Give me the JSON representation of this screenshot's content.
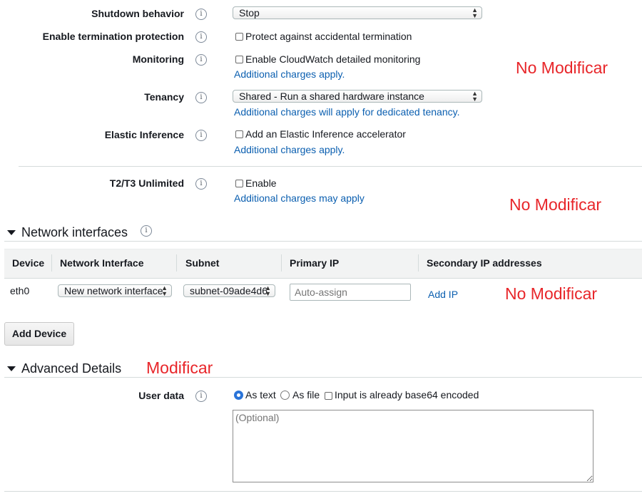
{
  "rows": {
    "shutdown": {
      "label": "Shutdown behavior",
      "value": "Stop"
    },
    "termination": {
      "label": "Enable termination protection",
      "checkbox": "Protect against accidental termination"
    },
    "monitoring": {
      "label": "Monitoring",
      "checkbox": "Enable CloudWatch detailed monitoring",
      "link": "Additional charges apply."
    },
    "tenancy": {
      "label": "Tenancy",
      "value": "Shared - Run a shared hardware instance",
      "link": "Additional charges will apply for dedicated tenancy."
    },
    "elastic": {
      "label": "Elastic Inference",
      "checkbox": "Add an Elastic Inference accelerator",
      "link": "Additional charges apply."
    },
    "t2t3": {
      "label": "T2/T3 Unlimited",
      "checkbox": "Enable",
      "link": "Additional charges may apply"
    }
  },
  "annotations": {
    "no_mod_1": "No Modificar",
    "no_mod_2": "No Modificar",
    "no_mod_3": "No Modificar",
    "mod": "Modificar"
  },
  "network": {
    "title": "Network interfaces",
    "headers": [
      "Device",
      "Network Interface",
      "Subnet",
      "Primary IP",
      "Secondary IP addresses"
    ],
    "row": {
      "device": "eth0",
      "interface": "New network interface",
      "subnet": "subnet-09ade4d6",
      "primary_ip_placeholder": "Auto-assign",
      "add_ip": "Add IP"
    },
    "add_device": "Add Device"
  },
  "advanced": {
    "title": "Advanced Details",
    "user_data": {
      "label": "User data",
      "as_text": "As text",
      "as_file": "As file",
      "base64": "Input is already base64 encoded",
      "placeholder": "(Optional)"
    }
  },
  "colors": {
    "annotation_red": "#e8262a",
    "link_blue": "#0b5fb0",
    "radio_blue": "#2a74d9"
  }
}
